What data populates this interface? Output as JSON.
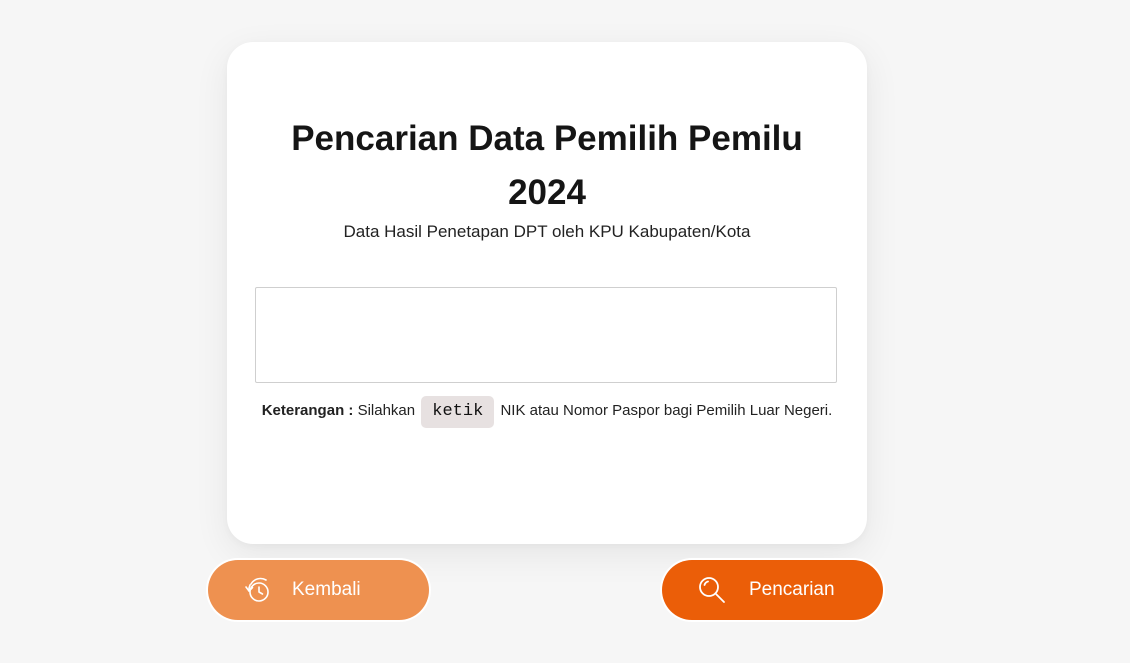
{
  "card": {
    "title": "Pencarian Data Pemilih Pemilu 2024",
    "subtitle": "Data Hasil Penetapan DPT oleh KPU Kabupaten/Kota"
  },
  "search": {
    "value": "",
    "placeholder": ""
  },
  "note": {
    "label": "Keterangan :",
    "text_before": "Silahkan",
    "highlight": "ketik",
    "text_after": "NIK atau Nomor Paspor bagi Pemilih Luar Negeri."
  },
  "buttons": {
    "back": {
      "label": "Kembali",
      "icon": "history-icon",
      "color": "#ee9150"
    },
    "search": {
      "label": "Pencarian",
      "icon": "search-icon",
      "color": "#eb5e08"
    }
  },
  "colors": {
    "background": "#f6f6f6",
    "card": "#ffffff",
    "accent": "#eb5e08",
    "accent_light": "#ee9150"
  }
}
